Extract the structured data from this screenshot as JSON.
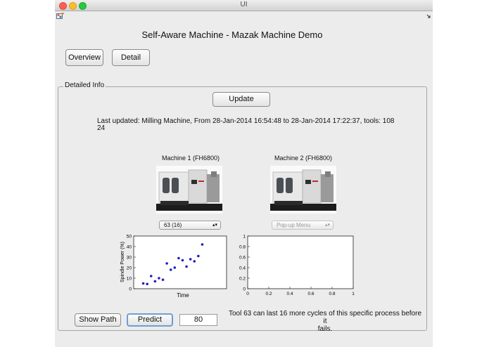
{
  "window": {
    "title": "UI"
  },
  "header": {
    "title": "Self-Aware Machine - Mazak Machine Demo"
  },
  "nav": {
    "overview_label": "Overview",
    "detail_label": "Detail"
  },
  "panel": {
    "label": "Detailed Info",
    "update_label": "Update",
    "last_updated_line1": "Last updated: Milling Machine, From 28-Jan-2014 16:54:48 to 28-Jan-2014 17:22:37, tools: 108",
    "last_updated_line2": "24"
  },
  "machines": [
    {
      "title": "Machine 1 (FH6800)",
      "select_value": "63 (16)"
    },
    {
      "title": "Machine 2 (FH6800)",
      "select_value": "Pop-up Menu"
    }
  ],
  "chart_data": [
    {
      "type": "scatter",
      "xlabel": "Time",
      "ylabel": "Spindle Power (%)",
      "ylim": [
        0,
        50
      ],
      "yticks": [
        "0",
        "10",
        "20",
        "30",
        "40",
        "50"
      ],
      "x": [
        1,
        2,
        3,
        4,
        5,
        6,
        7,
        8,
        9,
        10,
        11,
        12,
        13,
        14,
        15,
        16
      ],
      "y": [
        5,
        4.5,
        12,
        7,
        10,
        8.5,
        24,
        18,
        20,
        29,
        27,
        21,
        28,
        26,
        31,
        42
      ],
      "marker_color": "#1f1fbf"
    },
    {
      "type": "scatter",
      "xlim": [
        0,
        1
      ],
      "ylim": [
        0,
        1
      ],
      "xticks": [
        "0",
        "0.2",
        "0.4",
        "0.6",
        "0.8",
        "1"
      ],
      "yticks": [
        "0",
        "0.2",
        "0.4",
        "0.6",
        "0.8",
        "1"
      ]
    }
  ],
  "footer": {
    "show_path_label": "Show Path",
    "predict_label": "Predict",
    "number_value": "80",
    "prediction_line1": "Tool 63 can last 16 more cycles of this specific process before it",
    "prediction_line2": "fails."
  }
}
